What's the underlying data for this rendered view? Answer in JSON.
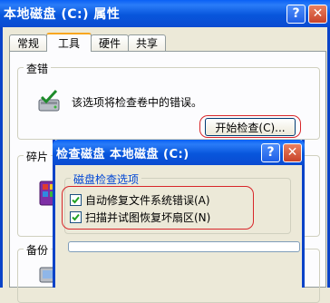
{
  "window": {
    "title": "本地磁盘 (C:) 属性",
    "help_glyph": "?",
    "close_glyph": "✕"
  },
  "tabs": [
    {
      "label": "常规"
    },
    {
      "label": "工具",
      "active": true
    },
    {
      "label": "硬件"
    },
    {
      "label": "共享"
    }
  ],
  "check_group": {
    "label": "查错",
    "description": "该选项将检查卷中的错误。",
    "button_label": "开始检查(C)..."
  },
  "defrag_group": {
    "label": "碎片"
  },
  "backup_group": {
    "label": "备份"
  },
  "check_dialog": {
    "title": "检查磁盘 本地磁盘 (C:)",
    "help_glyph": "?",
    "close_glyph": "✕",
    "options_label": "磁盘检查选项",
    "option1": {
      "label": "自动修复文件系统错误(A)",
      "checked": true
    },
    "option2": {
      "label": "扫描并试图恢复坏扇区(N)",
      "checked": true
    },
    "progress": 0
  },
  "colors": {
    "titlebar": "#0a56e0",
    "highlight_ring": "#d8262a",
    "active_tab_accent": "#f8a71f"
  },
  "icons": [
    "check-disk-icon",
    "defrag-icon",
    "backup-icon",
    "checkmark-icon"
  ]
}
